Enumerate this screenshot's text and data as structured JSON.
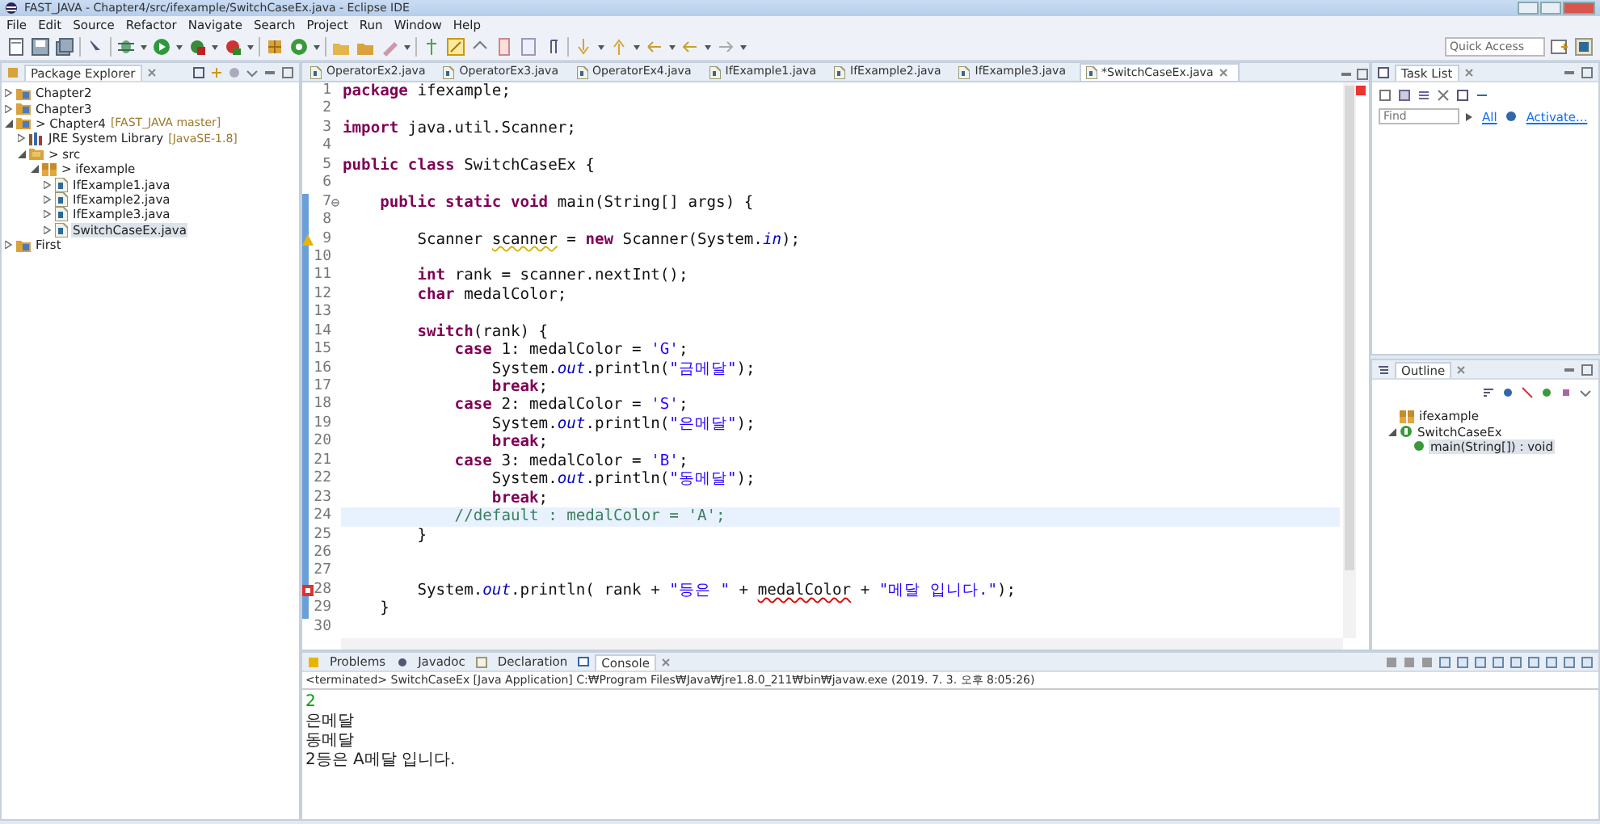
{
  "window": {
    "title": "FAST_JAVA - Chapter4/src/ifexample/SwitchCaseEx.java - Eclipse IDE"
  },
  "menu": [
    "File",
    "Edit",
    "Source",
    "Refactor",
    "Navigate",
    "Search",
    "Project",
    "Run",
    "Window",
    "Help"
  ],
  "quick_access": {
    "placeholder": "Quick Access"
  },
  "package_explorer": {
    "title": "Package Explorer",
    "tree": [
      {
        "label": "Chapter2",
        "kind": "project",
        "expanded": false,
        "selected": false
      },
      {
        "label": "Chapter3",
        "kind": "project",
        "expanded": false,
        "selected": false
      },
      {
        "label": "> Chapter4",
        "decoration": "[FAST_JAVA master]",
        "kind": "project",
        "expanded": true,
        "selected": false,
        "children": [
          {
            "label": "JRE System Library",
            "decoration": "[JavaSE-1.8]",
            "kind": "library",
            "expanded": false,
            "selected": false
          },
          {
            "label": "> src",
            "kind": "srcfolder",
            "expanded": true,
            "selected": false,
            "children": [
              {
                "label": "> ifexample",
                "kind": "package",
                "expanded": true,
                "selected": false,
                "children": [
                  {
                    "label": "IfExample1.java",
                    "kind": "java",
                    "expanded": false,
                    "selected": false
                  },
                  {
                    "label": "IfExample2.java",
                    "kind": "java",
                    "expanded": false,
                    "selected": false
                  },
                  {
                    "label": "IfExample3.java",
                    "kind": "java",
                    "expanded": false,
                    "selected": false
                  },
                  {
                    "label": "SwitchCaseEx.java",
                    "kind": "java",
                    "expanded": false,
                    "selected": true
                  }
                ]
              }
            ]
          }
        ]
      },
      {
        "label": "First",
        "kind": "project",
        "expanded": false,
        "selected": false
      }
    ]
  },
  "editor": {
    "tabs": [
      {
        "label": "OperatorEx2.java",
        "selected": false
      },
      {
        "label": "OperatorEx3.java",
        "selected": false
      },
      {
        "label": "OperatorEx4.java",
        "selected": false
      },
      {
        "label": "IfExample1.java",
        "selected": false
      },
      {
        "label": "IfExample2.java",
        "selected": false
      },
      {
        "label": "IfExample3.java",
        "selected": false
      },
      {
        "label": "*SwitchCaseEx.java",
        "selected": true
      }
    ],
    "lines": [
      {
        "number": "1",
        "kind": "code",
        "changed": false,
        "current": false,
        "tokens": [
          {
            "kind": "kw",
            "text": "package"
          },
          {
            "kind": "plain",
            "text": " ifexample;"
          }
        ]
      },
      {
        "number": "2",
        "kind": "code",
        "changed": false,
        "current": false
      },
      {
        "number": "3",
        "kind": "code",
        "changed": false,
        "current": false,
        "tokens": [
          {
            "kind": "kw",
            "text": "import"
          },
          {
            "kind": "plain",
            "text": " java.util.Scanner;"
          }
        ]
      },
      {
        "number": "4",
        "kind": "code",
        "changed": false,
        "current": false
      },
      {
        "number": "5",
        "kind": "code",
        "changed": false,
        "current": false,
        "tokens": [
          {
            "kind": "kw",
            "text": "public class"
          },
          {
            "kind": "plain",
            "text": " SwitchCaseEx {"
          }
        ]
      },
      {
        "number": "6",
        "kind": "code",
        "changed": false,
        "current": false
      },
      {
        "number": "7",
        "kind": "code",
        "changed": true,
        "current": false,
        "fold": true,
        "tokens": [
          {
            "kind": "kw",
            "text": "    public static void"
          },
          {
            "kind": "plain",
            "text": " main(String[] args) {"
          }
        ]
      },
      {
        "number": "8",
        "kind": "code",
        "changed": true,
        "current": false
      },
      {
        "number": "9",
        "kind": "warning",
        "changed": true,
        "current": false,
        "tokens": [
          {
            "kind": "plain",
            "text": "        Scanner "
          },
          {
            "kind": "warn",
            "text": "scanner"
          },
          {
            "kind": "plain",
            "text": " = "
          },
          {
            "kind": "kw",
            "text": "new"
          },
          {
            "kind": "plain",
            "text": " Scanner(System."
          },
          {
            "kind": "field",
            "text": "in"
          },
          {
            "kind": "plain",
            "text": ");"
          }
        ]
      },
      {
        "number": "10",
        "kind": "code",
        "changed": true,
        "current": false
      },
      {
        "number": "11",
        "kind": "code",
        "changed": true,
        "current": false,
        "tokens": [
          {
            "kind": "kw",
            "text": "        int"
          },
          {
            "kind": "plain",
            "text": " rank = scanner.nextInt();"
          }
        ]
      },
      {
        "number": "12",
        "kind": "code",
        "changed": true,
        "current": false,
        "tokens": [
          {
            "kind": "kw",
            "text": "        char"
          },
          {
            "kind": "plain",
            "text": " medalColor;"
          }
        ]
      },
      {
        "number": "13",
        "kind": "code",
        "changed": true,
        "current": false
      },
      {
        "number": "14",
        "kind": "code",
        "changed": true,
        "current": false,
        "tokens": [
          {
            "kind": "kw",
            "text": "        switch"
          },
          {
            "kind": "plain",
            "text": "(rank) {"
          }
        ]
      },
      {
        "number": "15",
        "kind": "code",
        "changed": true,
        "current": false,
        "tokens": [
          {
            "kind": "kw",
            "text": "            case"
          },
          {
            "kind": "plain",
            "text": " 1: medalColor = "
          },
          {
            "kind": "str",
            "text": "'G'"
          },
          {
            "kind": "plain",
            "text": ";"
          }
        ]
      },
      {
        "number": "16",
        "kind": "code",
        "changed": true,
        "current": false,
        "tokens": [
          {
            "kind": "plain",
            "text": "                System."
          },
          {
            "kind": "field",
            "text": "out"
          },
          {
            "kind": "plain",
            "text": ".println("
          },
          {
            "kind": "str",
            "text": "\"금메달\""
          },
          {
            "kind": "plain",
            "text": ");"
          }
        ]
      },
      {
        "number": "17",
        "kind": "code",
        "changed": true,
        "current": false,
        "tokens": [
          {
            "kind": "kw",
            "text": "                break"
          },
          {
            "kind": "plain",
            "text": ";"
          }
        ]
      },
      {
        "number": "18",
        "kind": "code",
        "changed": true,
        "current": false,
        "tokens": [
          {
            "kind": "kw",
            "text": "            case"
          },
          {
            "kind": "plain",
            "text": " 2: medalColor = "
          },
          {
            "kind": "str",
            "text": "'S'"
          },
          {
            "kind": "plain",
            "text": ";"
          }
        ]
      },
      {
        "number": "19",
        "kind": "code",
        "changed": true,
        "current": false,
        "tokens": [
          {
            "kind": "plain",
            "text": "                System."
          },
          {
            "kind": "field",
            "text": "out"
          },
          {
            "kind": "plain",
            "text": ".println("
          },
          {
            "kind": "str",
            "text": "\"은메달\""
          },
          {
            "kind": "plain",
            "text": ");"
          }
        ]
      },
      {
        "number": "20",
        "kind": "code",
        "changed": true,
        "current": false,
        "tokens": [
          {
            "kind": "kw",
            "text": "                break"
          },
          {
            "kind": "plain",
            "text": ";"
          }
        ]
      },
      {
        "number": "21",
        "kind": "code",
        "changed": true,
        "current": false,
        "tokens": [
          {
            "kind": "kw",
            "text": "            case"
          },
          {
            "kind": "plain",
            "text": " 3: medalColor = "
          },
          {
            "kind": "str",
            "text": "'B'"
          },
          {
            "kind": "plain",
            "text": ";"
          }
        ]
      },
      {
        "number": "22",
        "kind": "code",
        "changed": true,
        "current": false,
        "tokens": [
          {
            "kind": "plain",
            "text": "                System."
          },
          {
            "kind": "field",
            "text": "out"
          },
          {
            "kind": "plain",
            "text": ".println("
          },
          {
            "kind": "str",
            "text": "\"동메달\""
          },
          {
            "kind": "plain",
            "text": ");"
          }
        ]
      },
      {
        "number": "23",
        "kind": "code",
        "changed": true,
        "current": false,
        "tokens": [
          {
            "kind": "kw",
            "text": "                break"
          },
          {
            "kind": "plain",
            "text": ";"
          }
        ]
      },
      {
        "number": "24",
        "kind": "code",
        "changed": true,
        "current": true,
        "tokens": [
          {
            "kind": "comment",
            "text": "            //default : medalColor = 'A';"
          }
        ]
      },
      {
        "number": "25",
        "kind": "code",
        "changed": true,
        "current": false,
        "tokens": [
          {
            "kind": "plain",
            "text": "        }"
          }
        ]
      },
      {
        "number": "26",
        "kind": "code",
        "changed": true,
        "current": false
      },
      {
        "number": "27",
        "kind": "code",
        "changed": true,
        "current": false
      },
      {
        "number": "28",
        "kind": "error",
        "changed": true,
        "current": false,
        "tokens": [
          {
            "kind": "plain",
            "text": "        System."
          },
          {
            "kind": "field",
            "text": "out"
          },
          {
            "kind": "plain",
            "text": ".println( rank + "
          },
          {
            "kind": "str",
            "text": "\"등은 \""
          },
          {
            "kind": "plain",
            "text": " + "
          },
          {
            "kind": "error",
            "text": "medalColor"
          },
          {
            "kind": "plain",
            "text": " + "
          },
          {
            "kind": "str",
            "text": "\"메달 입니다.\""
          },
          {
            "kind": "plain",
            "text": ");"
          }
        ]
      },
      {
        "number": "29",
        "kind": "code",
        "changed": true,
        "current": false,
        "tokens": [
          {
            "kind": "plain",
            "text": "    }"
          }
        ]
      },
      {
        "number": "30",
        "kind": "code",
        "changed": false,
        "current": false
      }
    ]
  },
  "task_list": {
    "title": "Task List",
    "find": {
      "placeholder": "Find"
    },
    "filter": "All",
    "activate": "Activate..."
  },
  "outline": {
    "title": "Outline",
    "tree": [
      {
        "label": "ifexample",
        "kind": "package",
        "selected": false
      },
      {
        "label": "SwitchCaseEx",
        "kind": "class",
        "expanded": true,
        "selected": false,
        "children": [
          {
            "label": "main(String[]) : void",
            "kind": "method",
            "selected": true
          }
        ]
      }
    ]
  },
  "bottom_panel": {
    "tabs": [
      {
        "label": "Problems",
        "selected": false
      },
      {
        "label": "Javadoc",
        "selected": false
      },
      {
        "label": "Declaration",
        "selected": false
      },
      {
        "label": "Console",
        "selected": true
      }
    ],
    "console": {
      "header": "<terminated> SwitchCaseEx [Java Application] C:₩Program Files₩Java₩jre1.8.0_211₩bin₩javaw.exe (2019. 7. 3. 오후 8:05:26)",
      "output": [
        {
          "kind": "input",
          "text": "2"
        },
        {
          "kind": "output",
          "text": "은메달"
        },
        {
          "kind": "output",
          "text": "동메달"
        },
        {
          "kind": "output",
          "text": "2등은 A메달 입니다."
        }
      ]
    }
  }
}
